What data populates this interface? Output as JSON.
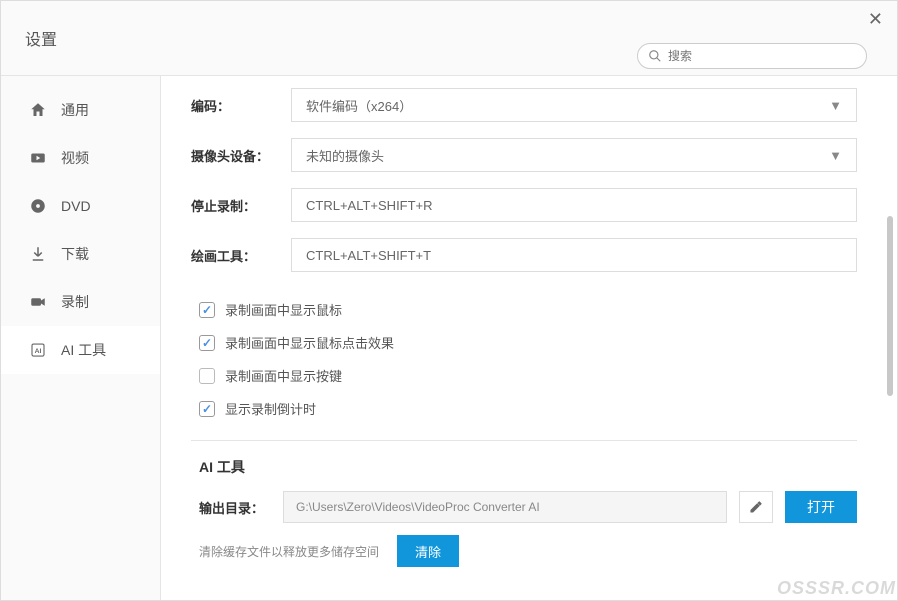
{
  "window": {
    "title": "设置"
  },
  "search": {
    "placeholder": "搜索"
  },
  "sidebar": {
    "items": [
      {
        "label": "通用"
      },
      {
        "label": "视频"
      },
      {
        "label": "DVD"
      },
      {
        "label": "下载"
      },
      {
        "label": "录制"
      },
      {
        "label": "AI 工具"
      }
    ]
  },
  "form": {
    "encoder": {
      "label": "编码：",
      "value": "软件编码（x264）"
    },
    "camera": {
      "label": "摄像头设备：",
      "value": "未知的摄像头"
    },
    "stopRec": {
      "label": "停止录制：",
      "value": "CTRL+ALT+SHIFT+R"
    },
    "drawTool": {
      "label": "绘画工具：",
      "value": "CTRL+ALT+SHIFT+T"
    }
  },
  "checks": {
    "showCursor": {
      "label": "录制画面中显示鼠标",
      "checked": true
    },
    "showClick": {
      "label": "录制画面中显示鼠标点击效果",
      "checked": true
    },
    "showKeys": {
      "label": "录制画面中显示按键",
      "checked": false
    },
    "showCountdown": {
      "label": "显示录制倒计时",
      "checked": true
    }
  },
  "aiSection": {
    "title": "AI 工具",
    "outputLabel": "输出目录：",
    "outputPath": "G:\\Users\\Zero\\Videos\\VideoProc Converter AI",
    "openBtn": "打开",
    "clearText": "清除缓存文件以释放更多储存空间",
    "clearBtn": "清除"
  },
  "watermark": "OSSSR.COM"
}
